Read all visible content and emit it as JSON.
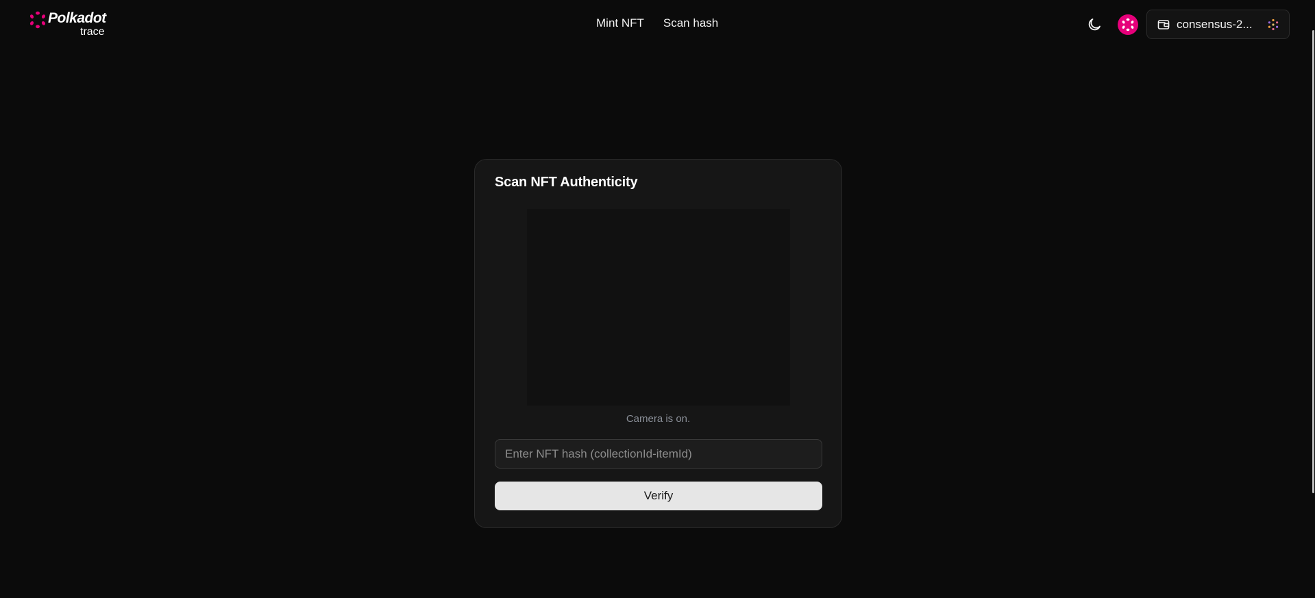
{
  "header": {
    "logo": {
      "wordmark": "Polkadot",
      "subtitle": "trace"
    },
    "nav": [
      {
        "label": "Mint NFT"
      },
      {
        "label": "Scan hash"
      }
    ],
    "theme_icon": "moon-icon",
    "network_icon": "polkadot-icon",
    "wallet": {
      "label": "consensus-2...",
      "icon": "wallet-icon",
      "identicon": "identicon"
    }
  },
  "card": {
    "title": "Scan NFT Authenticity",
    "camera_status": "Camera is on.",
    "hash_input": {
      "placeholder": "Enter NFT hash (collectionId-itemId)",
      "value": ""
    },
    "verify_label": "Verify"
  },
  "colors": {
    "background": "#0b0b0b",
    "card": "#161616",
    "brand": "#e6007a",
    "button": "#e6e6e6"
  }
}
